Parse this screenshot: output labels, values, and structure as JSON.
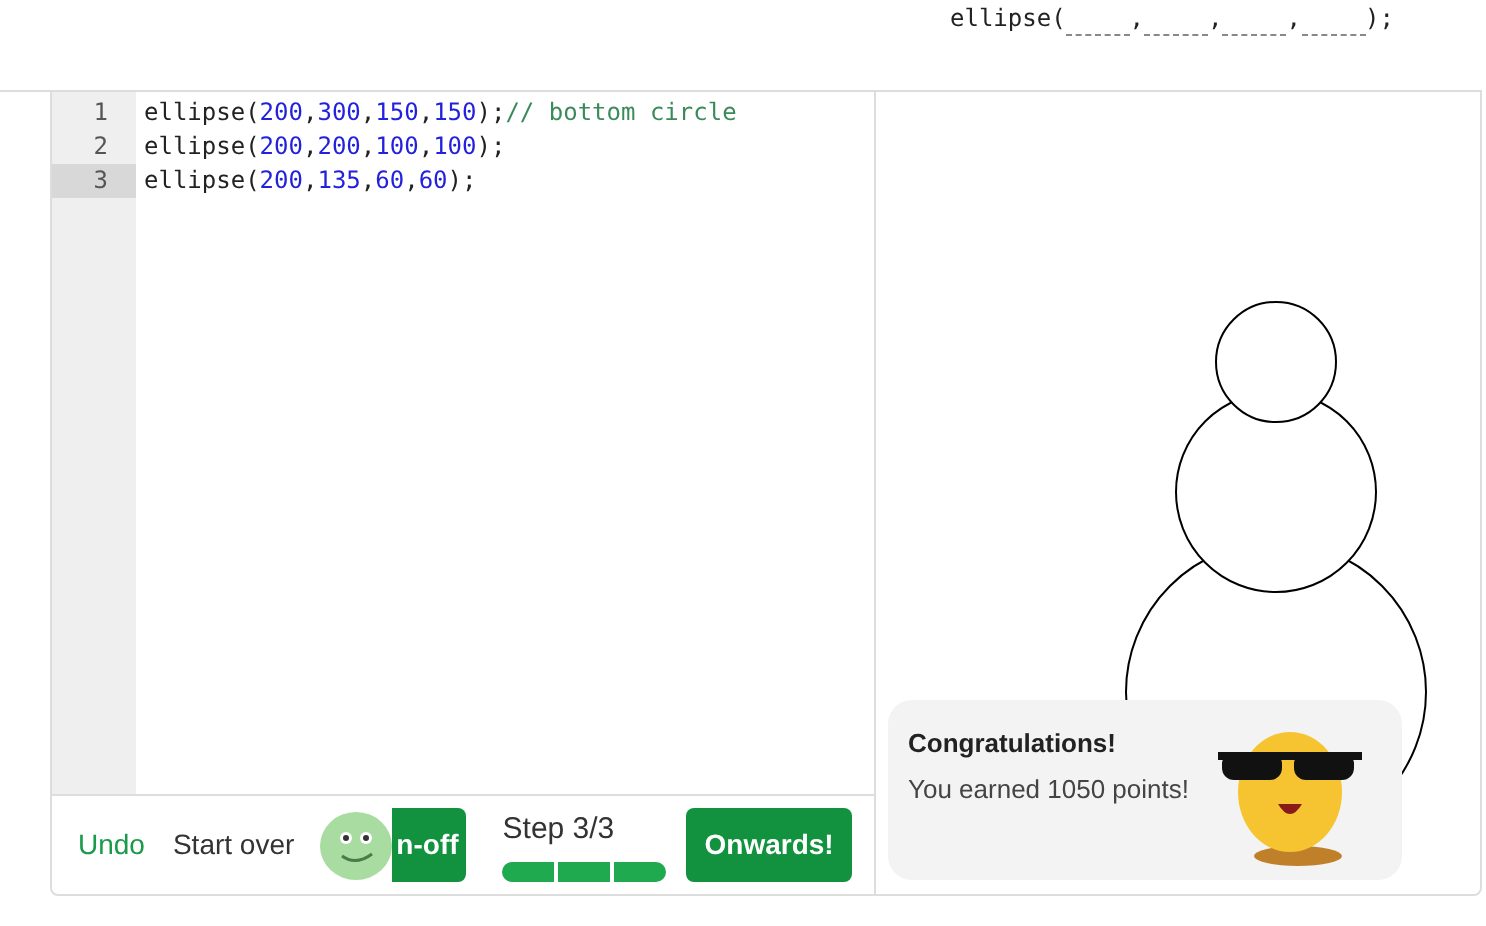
{
  "hint_code": {
    "prefix": "ellipse(",
    "separators": [
      ",",
      ",",
      ",",
      ");"
    ]
  },
  "editor": {
    "lines": [
      {
        "number": "1",
        "tokens": [
          {
            "kind": "plain",
            "text": "ellipse("
          },
          {
            "kind": "number",
            "text": "200"
          },
          {
            "kind": "plain",
            "text": ","
          },
          {
            "kind": "number",
            "text": "300"
          },
          {
            "kind": "plain",
            "text": ","
          },
          {
            "kind": "number",
            "text": "150"
          },
          {
            "kind": "plain",
            "text": ","
          },
          {
            "kind": "number",
            "text": "150"
          },
          {
            "kind": "plain",
            "text": ");"
          },
          {
            "kind": "comment",
            "text": "// bottom circle"
          }
        ],
        "selected": false
      },
      {
        "number": "2",
        "tokens": [
          {
            "kind": "plain",
            "text": "ellipse("
          },
          {
            "kind": "number",
            "text": "200"
          },
          {
            "kind": "plain",
            "text": ","
          },
          {
            "kind": "number",
            "text": "200"
          },
          {
            "kind": "plain",
            "text": ","
          },
          {
            "kind": "number",
            "text": "100"
          },
          {
            "kind": "plain",
            "text": ","
          },
          {
            "kind": "number",
            "text": "100"
          },
          {
            "kind": "plain",
            "text": ");"
          }
        ],
        "selected": false
      },
      {
        "number": "3",
        "tokens": [
          {
            "kind": "plain",
            "text": "ellipse("
          },
          {
            "kind": "number",
            "text": "200"
          },
          {
            "kind": "plain",
            "text": ","
          },
          {
            "kind": "number",
            "text": "135"
          },
          {
            "kind": "plain",
            "text": ","
          },
          {
            "kind": "number",
            "text": "60"
          },
          {
            "kind": "plain",
            "text": ","
          },
          {
            "kind": "number",
            "text": "60"
          },
          {
            "kind": "plain",
            "text": ");"
          }
        ],
        "selected": true
      }
    ]
  },
  "toolbar": {
    "undo": "Undo",
    "start_over": "Start over",
    "handoff": "n-off",
    "step": "Step 3/3",
    "segments": [
      {
        "done": true
      },
      {
        "done": true
      },
      {
        "done": true
      }
    ],
    "next": "Onwards!"
  },
  "popup": {
    "title": "Congratulations!",
    "message": "You earned 1050 points!"
  }
}
